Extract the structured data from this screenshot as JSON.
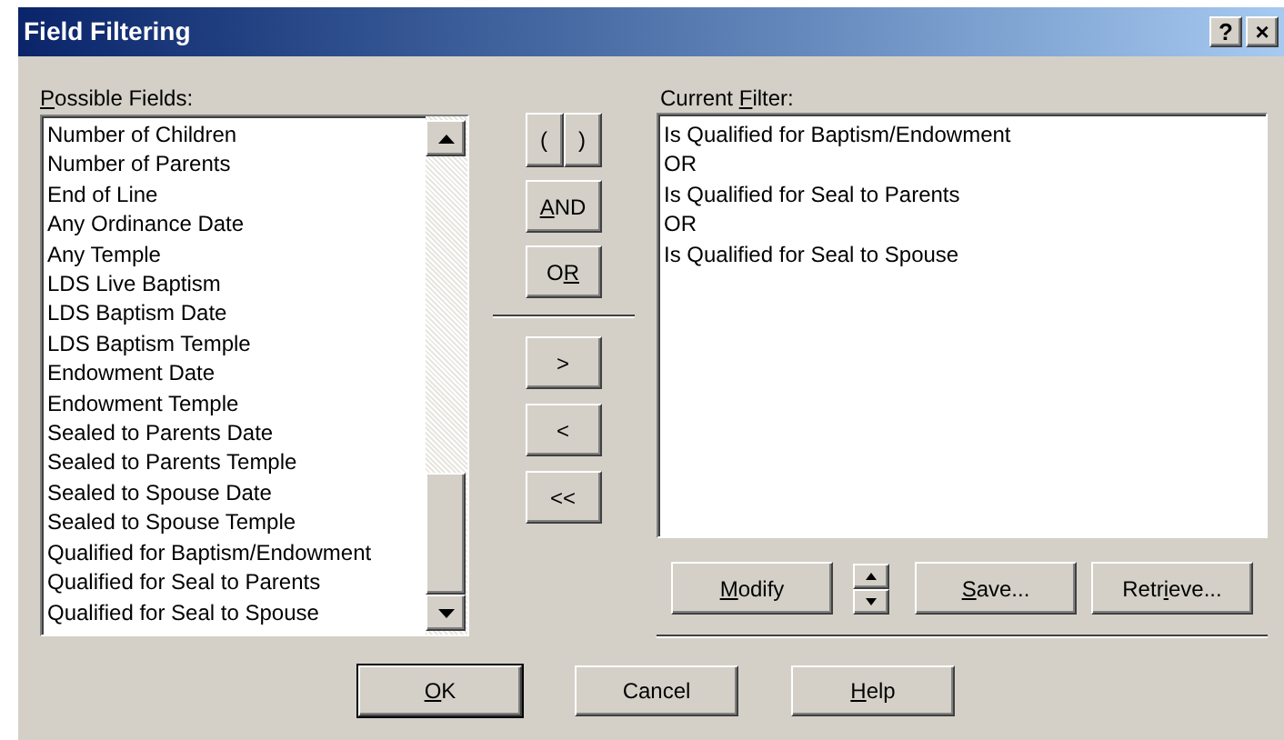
{
  "window": {
    "title": "Field Filtering",
    "title_buttons": [
      "?",
      "×"
    ]
  },
  "possible_fields": {
    "key": "P",
    "post": "ossible Fields:",
    "items": [
      "Number of Children",
      "Number of Parents",
      "End of Line",
      "Any Ordinance Date",
      "Any Temple",
      "LDS Live Baptism",
      "LDS Baptism Date",
      "LDS Baptism Temple",
      "Endowment Date",
      "Endowment Temple",
      "Sealed to Parents Date",
      "Sealed to Parents Temple",
      "Sealed to Spouse Date",
      "Sealed to Spouse Temple",
      "Qualified for Baptism/Endowment",
      "Qualified for Seal to Parents",
      "Qualified for Seal to Spouse"
    ]
  },
  "operators": {
    "parens": [
      "(",
      ")"
    ],
    "logic": [
      {
        "key": "A",
        "post": "ND"
      },
      {
        "pre": "O",
        "key": "R"
      }
    ],
    "move": [
      {
        "label": ">"
      },
      {
        "label": "<"
      },
      {
        "label": "<<"
      }
    ]
  },
  "current_filter": {
    "pre": "Current ",
    "key": "F",
    "post": "ilter:",
    "lines": [
      "Is Qualified for Baptism/Endowment",
      "OR",
      "Is Qualified for Seal to Parents",
      "OR",
      "Is Qualified for Seal to Spouse"
    ]
  },
  "filter_buttons": [
    {
      "kind": "button",
      "key": "M",
      "post": "odify"
    },
    {
      "kind": "spinner"
    },
    {
      "kind": "button",
      "key": "S",
      "post": "ave..."
    },
    {
      "kind": "button",
      "pre": "Retr",
      "key": "i",
      "post": "eve..."
    }
  ],
  "dialog_buttons": [
    {
      "key": "O",
      "post": "K",
      "default": true
    },
    {
      "label": "Cancel",
      "default": false
    },
    {
      "key": "H",
      "post": "elp",
      "default": false
    }
  ]
}
